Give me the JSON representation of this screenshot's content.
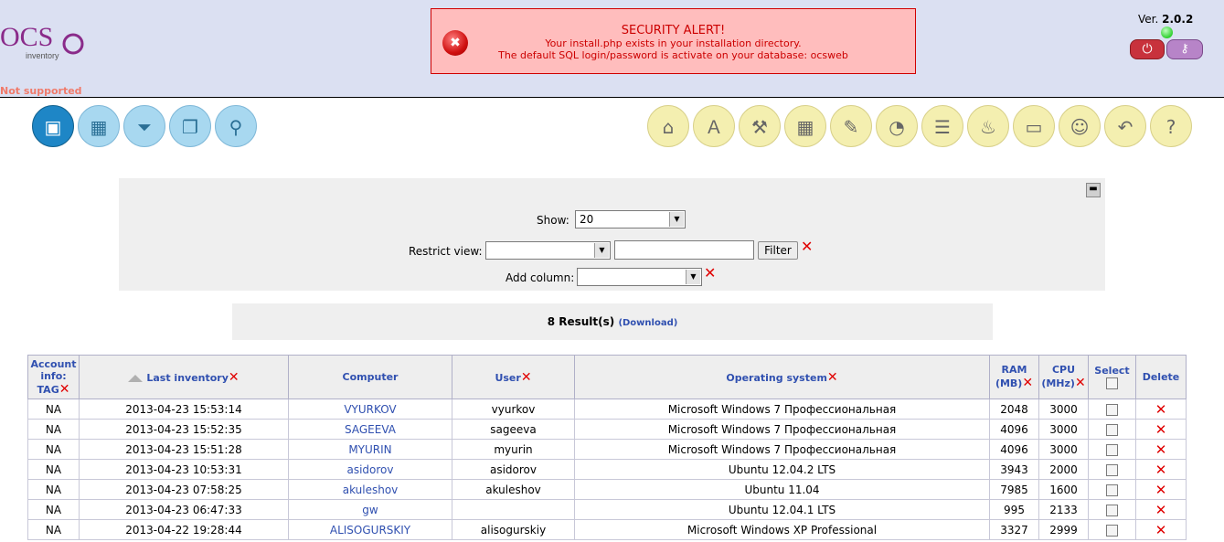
{
  "header": {
    "logo_text": "OCS inventory",
    "not_supported": "Not supported",
    "version_label": "Ver.",
    "version_value": "2.0.2"
  },
  "alert": {
    "title": "SECURITY ALERT!",
    "line1": "Your install.php exists in your installation directory.",
    "line2": "The default SQL login/password is activate on your database: ocsweb"
  },
  "nav_left": [
    "computers-icon",
    "network-icon",
    "filter-icon",
    "groups-icon",
    "search-icon"
  ],
  "nav_right": [
    "deploy-icon",
    "dictionary-icon",
    "config-icon",
    "software-icon",
    "help-desk-icon",
    "statistics-icon",
    "docs-icon",
    "firewall-icon",
    "ipdiscover-icon",
    "user-icon",
    "restore-icon",
    "help-icon"
  ],
  "filters": {
    "show_label": "Show:",
    "show_value": "20",
    "restrict_label": "Restrict view:",
    "restrict_value": "",
    "filter_button": "Filter",
    "add_column_label": "Add column:",
    "add_column_value": ""
  },
  "results": {
    "count_text": "8 Result(s)",
    "download": "(Download)"
  },
  "table": {
    "headers": {
      "tag": "Account info: TAG",
      "last_inventory": "Last inventory",
      "computer": "Computer",
      "user": "User",
      "os": "Operating system",
      "ram": "RAM (MB)",
      "cpu": "CPU (MHz)",
      "select": "Select",
      "delete": "Delete"
    },
    "rows": [
      {
        "tag": "NA",
        "last": "2013-04-23 15:53:14",
        "computer": "VYURKOV",
        "user": "vyurkov",
        "os": "Microsoft Windows 7 Профессиональная",
        "ram": "2048",
        "cpu": "3000"
      },
      {
        "tag": "NA",
        "last": "2013-04-23 15:52:35",
        "computer": "SAGEEVA",
        "user": "sageeva",
        "os": "Microsoft Windows 7 Профессиональная",
        "ram": "4096",
        "cpu": "3000"
      },
      {
        "tag": "NA",
        "last": "2013-04-23 15:51:28",
        "computer": "MYURIN",
        "user": "myurin",
        "os": "Microsoft Windows 7 Профессиональная",
        "ram": "4096",
        "cpu": "3000"
      },
      {
        "tag": "NA",
        "last": "2013-04-23 10:53:31",
        "computer": "asidorov",
        "user": "asidorov",
        "os": "Ubuntu 12.04.2 LTS",
        "ram": "3943",
        "cpu": "2000"
      },
      {
        "tag": "NA",
        "last": "2013-04-23 07:58:25",
        "computer": "akuleshov",
        "user": "akuleshov",
        "os": "Ubuntu 11.04",
        "ram": "7985",
        "cpu": "1600"
      },
      {
        "tag": "NA",
        "last": "2013-04-23 06:47:33",
        "computer": "gw",
        "user": "",
        "os": "Ubuntu 12.04.1 LTS",
        "ram": "995",
        "cpu": "2133"
      },
      {
        "tag": "NA",
        "last": "2013-04-22 19:28:44",
        "computer": "ALISOGURSKIY",
        "user": "alisogurskiy",
        "os": "Microsoft Windows XP Professional",
        "ram": "3327",
        "cpu": "2999"
      }
    ]
  }
}
